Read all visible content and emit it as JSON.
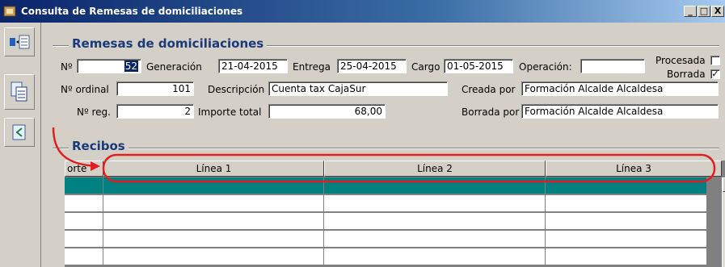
{
  "window": {
    "title": "Consulta de Remesas de domiciliaciones",
    "controls": {
      "minimize": "_",
      "maximize": "□",
      "close": "X"
    }
  },
  "toolbar": {
    "items": [
      {
        "icon": "list-view-icon"
      },
      {
        "icon": "copy-documents-icon"
      },
      {
        "icon": "back-arrow-document-icon"
      }
    ]
  },
  "remesa": {
    "section_title": "Remesas de domiciliaciones",
    "numero_label": "Nº",
    "numero_value": "52",
    "generacion_label": "Generación",
    "generacion_value": "21-04-2015",
    "entrega_label": "Entrega",
    "entrega_value": "25-04-2015",
    "cargo_label": "Cargo",
    "cargo_value": "01-05-2015",
    "operacion_label": "Operación:",
    "operacion_value": "",
    "procesada_label": "Procesada",
    "procesada_checked": false,
    "borrada_label": "Borrada",
    "borrada_checked": true,
    "ordinal_label": "Nº ordinal",
    "ordinal_value": "101",
    "descripcion_label": "Descripción",
    "descripcion_value": "Cuenta tax CajaSur",
    "creada_por_label": "Creada por",
    "creada_por_value": "Formación Alcalde Alcaldesa",
    "nreg_label": "Nº reg.",
    "nreg_value": "2",
    "importe_label": "Importe total",
    "importe_value": "68,00",
    "borrada_por_label": "Borrada por",
    "borrada_por_value": "Formación Alcalde Alcaldesa"
  },
  "recibos": {
    "section_title": "Recibos",
    "columns": [
      "orte",
      "Línea 1",
      "Línea 2",
      "Línea 3"
    ],
    "row_count": 5
  },
  "colors": {
    "title_bar": "#0a246a",
    "section_title": "#1a3a7a",
    "selected_row": "#008080",
    "annotation": "#e02020"
  }
}
